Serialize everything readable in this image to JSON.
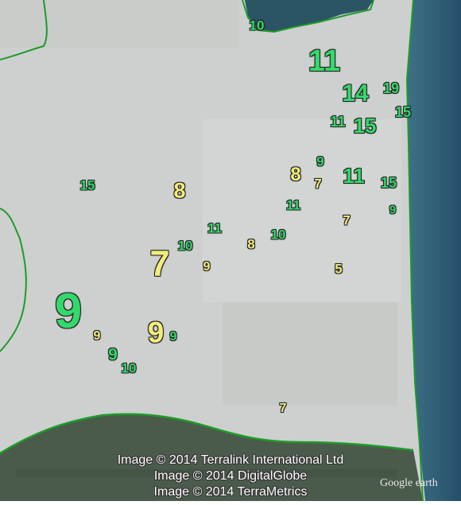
{
  "map": {
    "labels": [
      {
        "text": "10",
        "color": "green"
      },
      {
        "text": "11",
        "color": "green"
      },
      {
        "text": "14",
        "color": "green"
      },
      {
        "text": "19",
        "color": "green"
      },
      {
        "text": "15",
        "color": "green"
      },
      {
        "text": "11",
        "color": "green"
      },
      {
        "text": "15",
        "color": "green"
      },
      {
        "text": "9",
        "color": "green"
      },
      {
        "text": "8",
        "color": "yellow"
      },
      {
        "text": "7",
        "color": "yellow"
      },
      {
        "text": "11",
        "color": "green"
      },
      {
        "text": "15",
        "color": "green"
      },
      {
        "text": "15",
        "color": "green"
      },
      {
        "text": "8",
        "color": "yellow"
      },
      {
        "text": "11",
        "color": "green"
      },
      {
        "text": "9",
        "color": "green"
      },
      {
        "text": "7",
        "color": "yellow"
      },
      {
        "text": "11",
        "color": "green"
      },
      {
        "text": "10",
        "color": "green"
      },
      {
        "text": "8",
        "color": "yellow"
      },
      {
        "text": "10",
        "color": "green"
      },
      {
        "text": "7",
        "color": "yellow"
      },
      {
        "text": "9",
        "color": "yellow"
      },
      {
        "text": "5",
        "color": "yellow"
      },
      {
        "text": "9",
        "color": "green"
      },
      {
        "text": "9",
        "color": "yellow"
      },
      {
        "text": "9",
        "color": "yellow"
      },
      {
        "text": "9",
        "color": "green"
      },
      {
        "text": "9",
        "color": "green"
      },
      {
        "text": "10",
        "color": "green"
      },
      {
        "text": "7",
        "color": "yellow"
      }
    ],
    "colors": {
      "green": "#33d96a",
      "yellow": "#f3ec7a",
      "boundary": "#1f9a2a",
      "sea": "#2f5f70"
    },
    "attribution": [
      "Image © 2014 Terralink International Ltd",
      "Image © 2014 DigitalGlobe",
      "Image © 2014 TerraMetrics"
    ],
    "logo": "Google earth"
  }
}
